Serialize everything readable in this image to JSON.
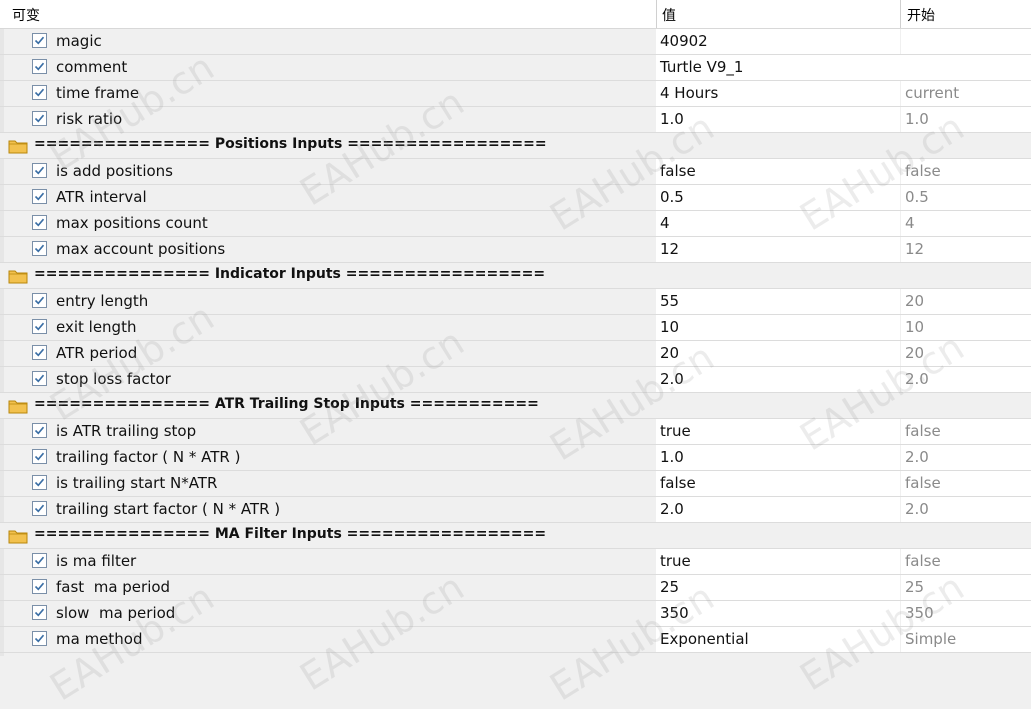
{
  "header": {
    "col_name": "可变",
    "col_value": "值",
    "col_start": "开始"
  },
  "rows": [
    {
      "type": "param",
      "name": "magic",
      "value": "40902",
      "start": ""
    },
    {
      "type": "param",
      "name": "comment",
      "value": "Turtle V9_1",
      "start": "",
      "wide": true
    },
    {
      "type": "param",
      "name": "time frame",
      "value": "4 Hours",
      "start": "current"
    },
    {
      "type": "param",
      "name": "risk ratio",
      "value": "1.0",
      "start": "1.0"
    },
    {
      "type": "group",
      "title": "=============== Positions Inputs ================="
    },
    {
      "type": "param",
      "name": "is add positions",
      "value": "false",
      "start": "false"
    },
    {
      "type": "param",
      "name": "ATR interval",
      "value": "0.5",
      "start": "0.5"
    },
    {
      "type": "param",
      "name": "max positions count",
      "value": "4",
      "start": "4"
    },
    {
      "type": "param",
      "name": "max account positions",
      "value": "12",
      "start": "12"
    },
    {
      "type": "group",
      "title": "=============== Indicator Inputs ================="
    },
    {
      "type": "param",
      "name": "entry length",
      "value": "55",
      "start": "20"
    },
    {
      "type": "param",
      "name": "exit length",
      "value": "10",
      "start": "10"
    },
    {
      "type": "param",
      "name": "ATR period",
      "value": "20",
      "start": "20"
    },
    {
      "type": "param",
      "name": "stop loss factor",
      "value": "2.0",
      "start": "2.0"
    },
    {
      "type": "group",
      "title": "=============== ATR Trailing Stop Inputs ==========="
    },
    {
      "type": "param",
      "name": "is ATR trailing stop",
      "value": "true",
      "start": "false"
    },
    {
      "type": "param",
      "name": "trailing factor ( N * ATR )",
      "value": "1.0",
      "start": "2.0"
    },
    {
      "type": "param",
      "name": "is trailing start N*ATR",
      "value": "false",
      "start": "false"
    },
    {
      "type": "param",
      "name": "trailing start factor ( N * ATR )",
      "value": "2.0",
      "start": "2.0"
    },
    {
      "type": "group",
      "title": "=============== MA Filter Inputs ================="
    },
    {
      "type": "param",
      "name": "is ma filter",
      "value": "true",
      "start": "false"
    },
    {
      "type": "param",
      "name": "fast  ma period",
      "value": "25",
      "start": "25"
    },
    {
      "type": "param",
      "name": "slow  ma period",
      "value": "350",
      "start": "350"
    },
    {
      "type": "param",
      "name": "ma method",
      "value": "Exponential",
      "start": "Simple"
    }
  ],
  "watermark": "EAHub.cn",
  "colors": {
    "checkbox_border": "#7a8fa8",
    "check_mark": "#3a6ea5",
    "folder": "#f2c14e"
  }
}
